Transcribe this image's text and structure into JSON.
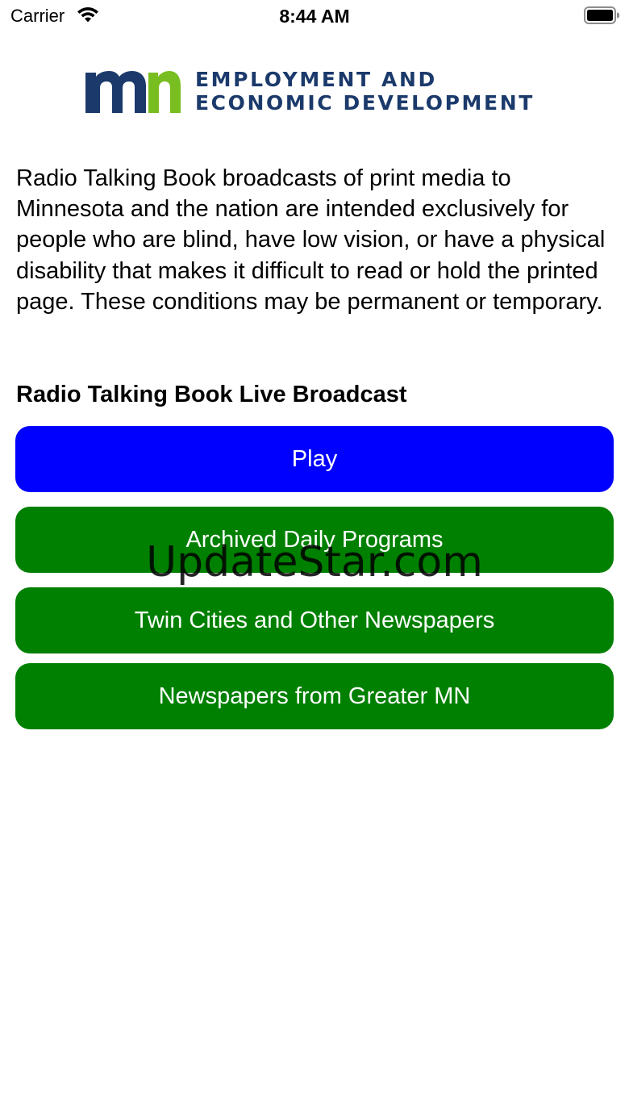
{
  "status_bar": {
    "carrier": "Carrier",
    "time": "8:44 AM",
    "icons": [
      "wifi-icon",
      "battery-icon"
    ]
  },
  "logo": {
    "line1": "EMPLOYMENT AND",
    "line2": "ECONOMIC DEVELOPMENT",
    "colors": {
      "mark_blue": "#1b3a6b",
      "mark_green": "#78be20",
      "text": "#1b3a6b"
    }
  },
  "intro": "Radio Talking Book broadcasts of print media to Minnesota and the nation are intended exclusively for people who are blind, have low vision, or have a physical disability that makes it difficult to read or hold the printed page. These conditions may be permanent or temporary.",
  "section_title": "Radio Talking Book Live Broadcast",
  "buttons": {
    "play": "Play",
    "archived": "Archived Daily Programs",
    "twin_cities": "Twin Cities and Other Newspapers",
    "greater_mn": "Newspapers from Greater MN"
  },
  "colors": {
    "play_button": "#0000ff",
    "nav_button": "#008000"
  },
  "watermark": "UpdateStar.com"
}
